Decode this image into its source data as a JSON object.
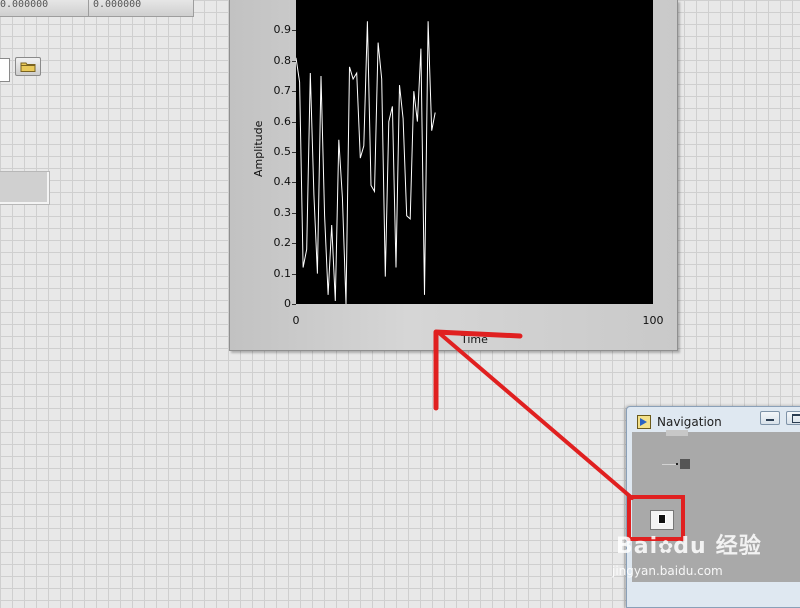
{
  "top_controls": {
    "left_value": "0.000000",
    "right_value": "0.000000"
  },
  "graph": {
    "xlabel": "Time",
    "ylabel": "Amplitude",
    "plot_bg": "#000000",
    "trace_color": "#ffffff"
  },
  "chart_data": {
    "type": "line",
    "xlabel": "Time",
    "ylabel": "Amplitude",
    "xlim": [
      0,
      100
    ],
    "ylim": [
      0,
      1
    ],
    "x_ticks": [
      "0",
      "100"
    ],
    "y_ticks": [
      "0",
      "0.1",
      "0.2",
      "0.3",
      "0.4",
      "0.5",
      "0.6",
      "0.7",
      "0.8",
      "0.9"
    ],
    "series": [
      {
        "x": [
          0,
          1,
          2,
          3,
          4,
          5,
          6,
          7,
          8,
          9,
          10,
          11,
          12,
          13,
          14,
          15,
          16,
          17,
          18,
          19,
          20,
          21,
          22,
          23,
          24,
          25,
          26,
          27,
          28,
          29,
          30,
          31,
          32,
          33,
          34,
          35,
          36,
          37,
          38,
          39
        ],
        "values": [
          0.81,
          0.73,
          0.12,
          0.18,
          0.76,
          0.36,
          0.1,
          0.75,
          0.29,
          0.03,
          0.26,
          0.01,
          0.54,
          0.35,
          0.0,
          0.78,
          0.74,
          0.76,
          0.48,
          0.52,
          0.93,
          0.39,
          0.37,
          0.86,
          0.74,
          0.09,
          0.6,
          0.65,
          0.12,
          0.72,
          0.61,
          0.29,
          0.28,
          0.7,
          0.6,
          0.84,
          0.03,
          0.93,
          0.57,
          0.63
        ]
      }
    ],
    "grid": false
  },
  "navigation": {
    "title": "Navigation",
    "window_bg": "#a9a9a9"
  },
  "annotation": {
    "color": "#e02020"
  },
  "watermark": {
    "brand": "Bai",
    "brand_suffix": "du",
    "product": "经验",
    "url": "jingyan.baidu.com"
  }
}
